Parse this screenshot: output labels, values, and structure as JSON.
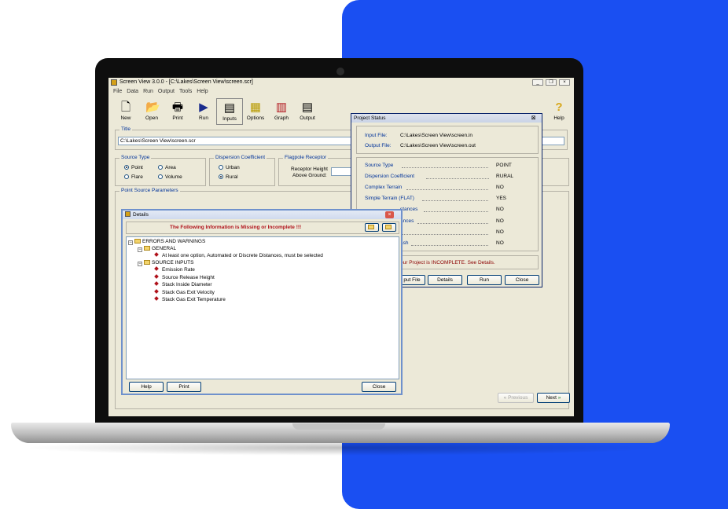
{
  "window": {
    "title": "Screen View 3.0.0 - [C:\\Lakes\\Screen View\\screen.scr]",
    "menus": [
      "File",
      "Data",
      "Run",
      "Output",
      "Tools",
      "Help"
    ]
  },
  "toolbar": {
    "buttons": [
      {
        "label": "New",
        "icon": "new-file-icon"
      },
      {
        "label": "Open",
        "icon": "open-folder-icon"
      },
      {
        "label": "Print",
        "icon": "printer-icon"
      },
      {
        "label": "Run",
        "icon": "run-arrow-icon"
      },
      {
        "label": "Inputs",
        "icon": "inputs-icon"
      },
      {
        "label": "Options",
        "icon": "options-grid-icon"
      },
      {
        "label": "Graph",
        "icon": "bar-graph-icon"
      },
      {
        "label": "Output",
        "icon": "output-document-icon"
      },
      {
        "label": "Help",
        "icon": "question-icon"
      }
    ]
  },
  "main": {
    "title_label": "Title",
    "title_value": "C:\\Lakes\\Screen View\\screen.scr",
    "source_type": {
      "label": "Source Type",
      "options": [
        {
          "label": "Point",
          "selected": true
        },
        {
          "label": "Area",
          "selected": false
        },
        {
          "label": "Flare",
          "selected": false
        },
        {
          "label": "Volume",
          "selected": false
        }
      ]
    },
    "dispersion": {
      "label": "Dispersion Coefficient",
      "options": [
        {
          "label": "Urban",
          "selected": false
        },
        {
          "label": "Rural",
          "selected": true
        }
      ]
    },
    "flagpole": {
      "label": "Flagpole Receptor",
      "line1": "Receptor Height",
      "line2": "Above Ground:"
    },
    "point_source_label": "Point Source Parameters",
    "previous_label": "Previous",
    "next_label": "Next"
  },
  "project_status": {
    "title": "Project Status",
    "input_file_label": "Input File:",
    "input_file_value": "C:\\Lakes\\Screen View\\screen.in",
    "output_file_label": "Output File:",
    "output_file_value": "C:\\Lakes\\Screen View\\screen.out",
    "rows": [
      {
        "label": "Source Type",
        "value": "POINT"
      },
      {
        "label": "Dispersion Coefficient",
        "value": "RURAL"
      },
      {
        "label": "Complex Terrain",
        "value": "NO"
      },
      {
        "label": "Simple Terrain  (FLAT)",
        "value": "YES"
      },
      {
        "label": "stances",
        "value": "NO"
      },
      {
        "label": "ances",
        "value": "NO"
      },
      {
        "label": "",
        "value": "NO"
      },
      {
        "label": "ash",
        "value": "NO"
      }
    ],
    "message": "our Project is INCOMPLETE.  See Details.",
    "buttons": [
      "put File",
      "Details",
      "Run",
      "Close"
    ]
  },
  "details": {
    "title": "Details",
    "heading": "The Following Information is Missing or Incomplete !!!",
    "tree": {
      "root": "ERRORS AND WARNINGS",
      "general": "GENERAL",
      "general_items": [
        "At least one option, Automated or Discrete Distances, must be selected"
      ],
      "source_inputs": "SOURCE INPUTS",
      "source_items": [
        "Emission Rate",
        "Source Release Height",
        "Stack Inside Diameter",
        "Stack Gas Exit Velocity",
        "Stack Gas Exit Temperature"
      ]
    },
    "buttons": {
      "help": "Help",
      "print": "Print",
      "close": "Close"
    }
  },
  "colors": {
    "accent_panel": "#1a4ff2",
    "window_bg": "#ece9d8",
    "label_blue": "#00339a",
    "warning_red": "#b0121b"
  }
}
